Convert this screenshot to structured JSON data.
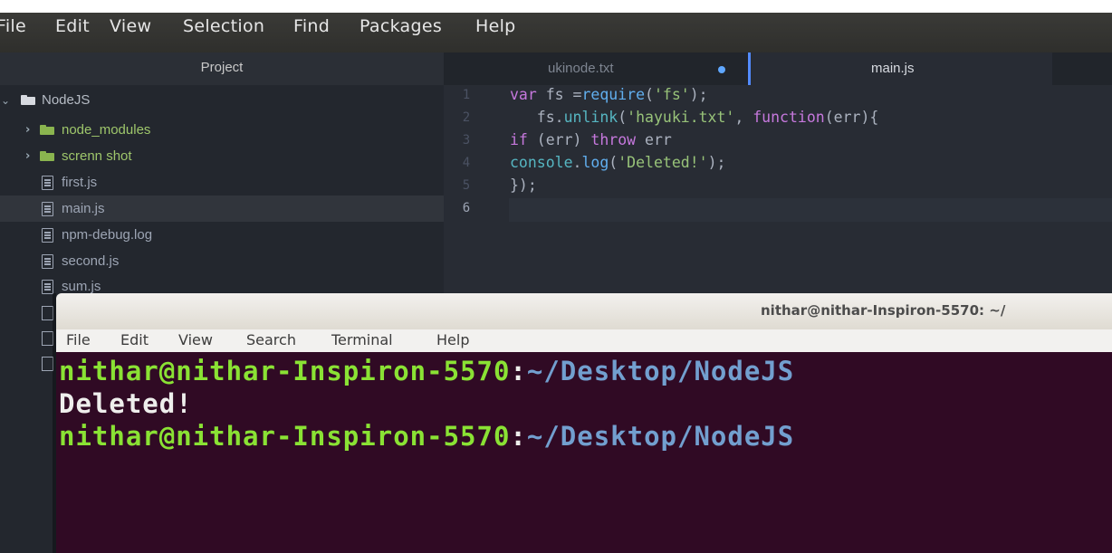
{
  "atom": {
    "menu": [
      "File",
      "Edit",
      "View",
      "Selection",
      "Find",
      "Packages",
      "Help"
    ],
    "tree": {
      "header": "Project",
      "root": "NodeJS",
      "items": [
        {
          "label": "node_modules",
          "type": "folder"
        },
        {
          "label": "screnn shot",
          "type": "folder"
        },
        {
          "label": "first.js",
          "type": "file"
        },
        {
          "label": "main.js",
          "type": "file",
          "selected": true
        },
        {
          "label": "npm-debug.log",
          "type": "file"
        },
        {
          "label": "second.js",
          "type": "file"
        },
        {
          "label": "sum.js",
          "type": "file"
        }
      ]
    },
    "tabs": [
      {
        "label": "ukinode.txt",
        "modified": true,
        "active": false
      },
      {
        "label": "main.js",
        "modified": false,
        "active": true
      }
    ],
    "editor": {
      "line_numbers": [
        "1",
        "2",
        "3",
        "4",
        "5",
        "6"
      ],
      "lines": [
        {
          "parts": [
            {
              "t": "var",
              "c": "kw"
            },
            {
              "t": " fs =",
              "c": "plain"
            },
            {
              "t": "require",
              "c": "fn"
            },
            {
              "t": "(",
              "c": "plain"
            },
            {
              "t": "'fs'",
              "c": "str"
            },
            {
              "t": ");",
              "c": "plain"
            }
          ]
        },
        {
          "parts": [
            {
              "t": "   fs.",
              "c": "plain"
            },
            {
              "t": "unlink",
              "c": "obj"
            },
            {
              "t": "(",
              "c": "plain"
            },
            {
              "t": "'hayuki.txt'",
              "c": "str"
            },
            {
              "t": ", ",
              "c": "plain"
            },
            {
              "t": "function",
              "c": "kw"
            },
            {
              "t": "(err){",
              "c": "plain"
            }
          ]
        },
        {
          "parts": [
            {
              "t": "if",
              "c": "kw"
            },
            {
              "t": " (err) ",
              "c": "plain"
            },
            {
              "t": "throw",
              "c": "kw"
            },
            {
              "t": " err",
              "c": "plain"
            }
          ]
        },
        {
          "parts": [
            {
              "t": "console",
              "c": "obj"
            },
            {
              "t": ".",
              "c": "plain"
            },
            {
              "t": "log",
              "c": "fn"
            },
            {
              "t": "(",
              "c": "plain"
            },
            {
              "t": "'Deleted!'",
              "c": "str"
            },
            {
              "t": ");",
              "c": "plain"
            }
          ]
        },
        {
          "parts": [
            {
              "t": "});",
              "c": "plain"
            }
          ]
        },
        {
          "parts": []
        }
      ]
    }
  },
  "terminal": {
    "title": "nithar@nithar-Inspiron-5570: ~/",
    "menu": [
      "File",
      "Edit",
      "View",
      "Search",
      "Terminal",
      "Help"
    ],
    "lines": [
      {
        "parts": [
          {
            "t": "nithar@nithar-Inspiron-5570",
            "c": "tg"
          },
          {
            "t": ":",
            "c": "tw"
          },
          {
            "t": "~/Desktop/NodeJS",
            "c": "tb"
          }
        ]
      },
      {
        "parts": [
          {
            "t": "Deleted!",
            "c": "tw"
          }
        ]
      },
      {
        "parts": [
          {
            "t": "nithar@nithar-Inspiron-5570",
            "c": "tg"
          },
          {
            "t": ":",
            "c": "tw"
          },
          {
            "t": "~/Desktop/NodeJS",
            "c": "tb"
          }
        ]
      }
    ]
  },
  "colors": {
    "folder_gray": "#d7dae0",
    "folder_green": "#8ab44f",
    "accent_blue": "#528bff",
    "terminal_bg": "#300a24"
  }
}
